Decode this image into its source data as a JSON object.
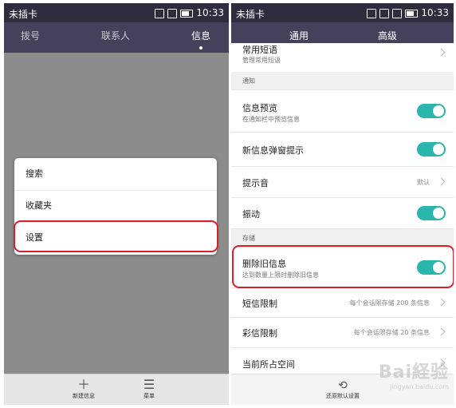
{
  "status": {
    "carrier": "未插卡",
    "time": "10:33"
  },
  "left": {
    "tabs": [
      "拨号",
      "联系人",
      "信息"
    ],
    "menu": [
      "搜索",
      "收藏夹",
      "设置"
    ],
    "bottom": {
      "new_message": "新建信息",
      "menu": "菜单"
    }
  },
  "right": {
    "tabs": [
      "通用",
      "高级"
    ],
    "partial_row": {
      "title": "常用短语",
      "sub": "管理常用短语"
    },
    "sections": {
      "notify": "通知",
      "storage": "存储"
    },
    "rows": {
      "preview": {
        "title": "信息预览",
        "sub": "在通知栏中预览信息"
      },
      "popup": {
        "title": "新信息弹窗提示"
      },
      "sound": {
        "title": "提示音",
        "value": "默认"
      },
      "vibrate": {
        "title": "振动"
      },
      "delete_old": {
        "title": "删除旧信息",
        "sub": "达到数量上限时删除旧信息"
      },
      "sms_limit": {
        "title": "短信限制",
        "value": "每个会话限存储 200 条信息"
      },
      "mms_limit": {
        "title": "彩信限制",
        "value": "每个会话限存储 20 条信息"
      },
      "space": {
        "title": "当前所占空间"
      }
    },
    "footer": {
      "restore": "还原默认设置"
    }
  },
  "watermark": {
    "text": "Bai経验",
    "sub": "jingyan.baidu.com"
  },
  "colors": {
    "accent": "#2ab5ad",
    "header": "#45415a",
    "highlight": "#d9202c"
  },
  "icons": [
    "plus-icon",
    "menu-icon",
    "restore-icon",
    "chevron-right-icon"
  ]
}
